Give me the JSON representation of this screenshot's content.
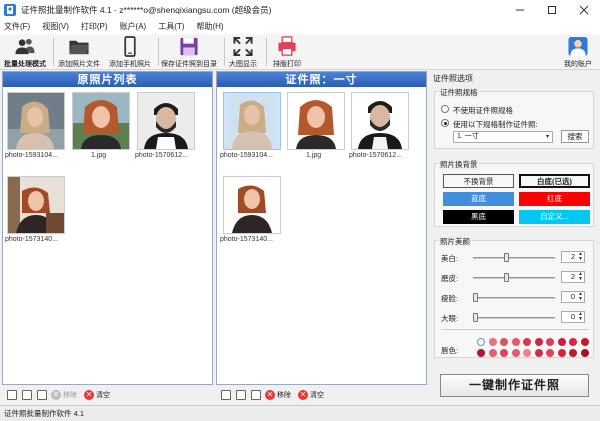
{
  "window": {
    "title": "证件照批量制作软件 4.1 - z******o@shenqixiangsu.com (超级会员)"
  },
  "menu": [
    "文件(F)",
    "视图(V)",
    "打印(P)",
    "账户(A)",
    "工具(T)",
    "帮助(H)"
  ],
  "toolbar": {
    "batch": "批量处理模式",
    "add_file": "添加照片文件",
    "add_phone": "添加手机照片",
    "save": "保存证件照到目录",
    "bigview": "大图显示",
    "print": "排版打印",
    "account": "我的账户"
  },
  "left_panel": {
    "title": "原照片列表",
    "items": [
      "photo-1593104...",
      "1.jpg",
      "photo-1570612...",
      "photo-1573140..."
    ],
    "footer": {
      "remove": "移除",
      "clear": "清空"
    }
  },
  "mid_panel": {
    "title": "证件照：一寸",
    "items": [
      "photo-1593104...",
      "1.jpg",
      "photo-1570612...",
      "photo-1573140..."
    ],
    "footer": {
      "remove": "移除",
      "clear": "清空"
    }
  },
  "options": {
    "header": "证件照选项",
    "spec": {
      "title": "证件照规格",
      "opt_none": "不使用证件照规格",
      "opt_use": "使用以下规格制作证件照:",
      "selected": "1. 一寸",
      "search": "搜索"
    },
    "bg": {
      "title": "照片换背景",
      "buttons": [
        {
          "label": "不换背景",
          "bg": "#ffffff",
          "fg": "#222222"
        },
        {
          "label": "白底(已选)",
          "bg": "#ffffff",
          "fg": "#222222"
        },
        {
          "label": "蓝底",
          "bg": "#438edb",
          "fg": "#ffffff"
        },
        {
          "label": "红底",
          "bg": "#ff0000",
          "fg": "#ffffff"
        },
        {
          "label": "黑底",
          "bg": "#000000",
          "fg": "#ffffff"
        },
        {
          "label": "自定义...",
          "bg": "#00c8f0",
          "fg": "#ffffff"
        }
      ]
    },
    "beauty": {
      "title": "照片美颜",
      "sliders": [
        {
          "label": "美白:",
          "value": "2",
          "level": 0.4
        },
        {
          "label": "磨皮:",
          "value": "2",
          "level": 0.4
        },
        {
          "label": "瘦脸:",
          "value": "0",
          "level": 0
        },
        {
          "label": "大眼:",
          "value": "0",
          "level": 0
        }
      ],
      "lip_label": "唇色:",
      "lip_colors": [
        "#ffffff",
        "#e8747c",
        "#e0525e",
        "#e85a6a",
        "#d63a4a",
        "#c82a48",
        "#d84050",
        "#cc1c40",
        "#e0204a",
        "#c4182c",
        "#b01438",
        "#e06070",
        "#d84858",
        "#e85868",
        "#f08090",
        "#c83048",
        "#e44058",
        "#d02838",
        "#b81c30",
        "#a01428"
      ]
    },
    "make": "一键制作证件照"
  },
  "status": "证件照批量制作软件 4.1"
}
